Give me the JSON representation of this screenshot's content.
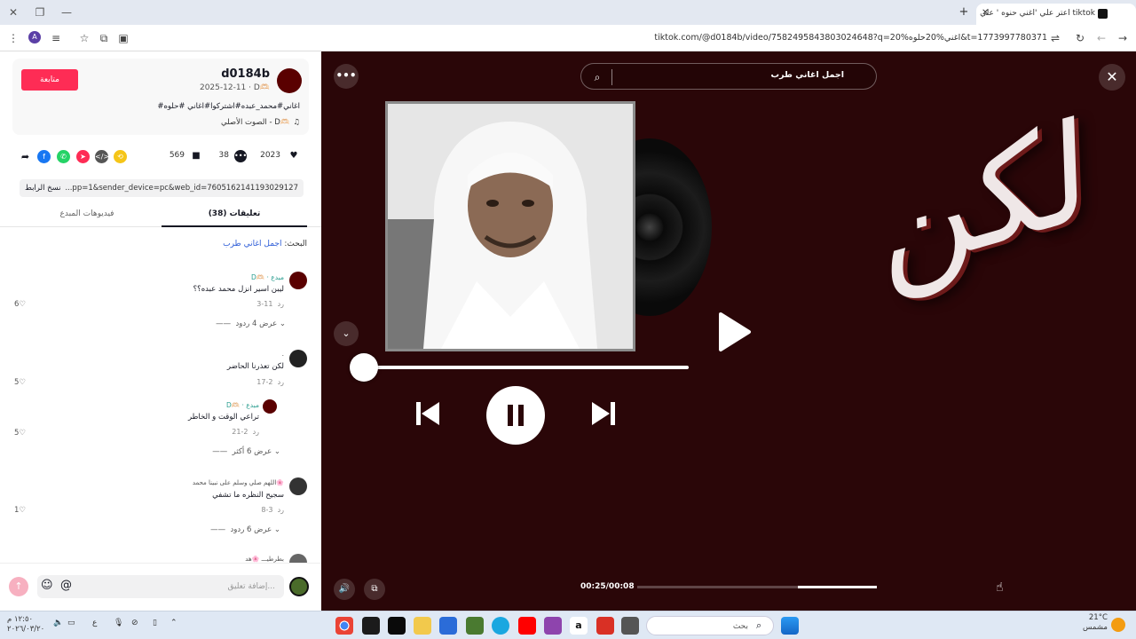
{
  "browser": {
    "tab_title": "اعتر علي 'اغني حنوه ' علي tiktok",
    "new_tab_label": "+",
    "url": "tiktok.com/@d0184b/video/7582495843803024648?q=20%اغني%20حلوه&t=1773997780371",
    "profile_initial": "A"
  },
  "post": {
    "username": "d0184b",
    "meta": "2025-12-11 · D🫶🏻",
    "follow_label": "متابعة",
    "caption": "#اغاني#محمد_عبده#اشتركوا#اغاني #حلوه",
    "sound": "الصوت الأصلي - D🫶🏻",
    "likes": "2023",
    "comments": "38",
    "saves": "569",
    "link": "...pp=1&sender_device=pc&web_id=7605162141193029127",
    "copy_label": "نسخ الرابط"
  },
  "tabs": {
    "comments_tab": "(38) تعليقات",
    "creator_videos_tab": "فيديوهات المبدع"
  },
  "search_hint": {
    "prefix": "البحث:",
    "query": "اجمل اغاني طرب"
  },
  "comments": [
    {
      "name": "D🫶🏻 · مبدع",
      "text": "ليبن اسير انزل محمد عبده؟؟",
      "date": "11-3",
      "reply": "رد",
      "likes": "6",
      "replies": "عرض 4 ردود"
    },
    {
      "name": ".",
      "text": "لكن تعذرنا الحاضر",
      "date": "2-17",
      "reply": "رد",
      "likes": "5",
      "replies": ""
    },
    {
      "name": "D🫶🏻 · مبدع",
      "text": "تراعي الوقت و الخاطر",
      "date": "2-21",
      "reply": "رد",
      "likes": "5",
      "replies": "عرض 6 أكثر"
    },
    {
      "name": "اللهم صلي وسلم على نبينا محمد🌸",
      "text": "سجيح النظره ما تشفي",
      "date": "3-8",
      "reply": "رد",
      "likes": "1",
      "replies": "عرض 6 ردود"
    },
    {
      "name": "بطرطيـــ 🌸هد",
      "text": "",
      "date": "",
      "reply": "",
      "likes": "",
      "replies": ""
    }
  ],
  "comment_input": {
    "placeholder": "إضافة تعليق..."
  },
  "video": {
    "search_text": "اجمل اغاني طرب",
    "overlay_text": "لكن",
    "time": "00:25/00:08",
    "progress": 0.33
  },
  "taskbar": {
    "search_placeholder": "بحث",
    "weather_temp": "21°C",
    "weather_desc": "مشمس",
    "clock_time": "١٢:٥٠ م",
    "clock_date": "٢٠٢٦/٠٣/٢٠"
  }
}
